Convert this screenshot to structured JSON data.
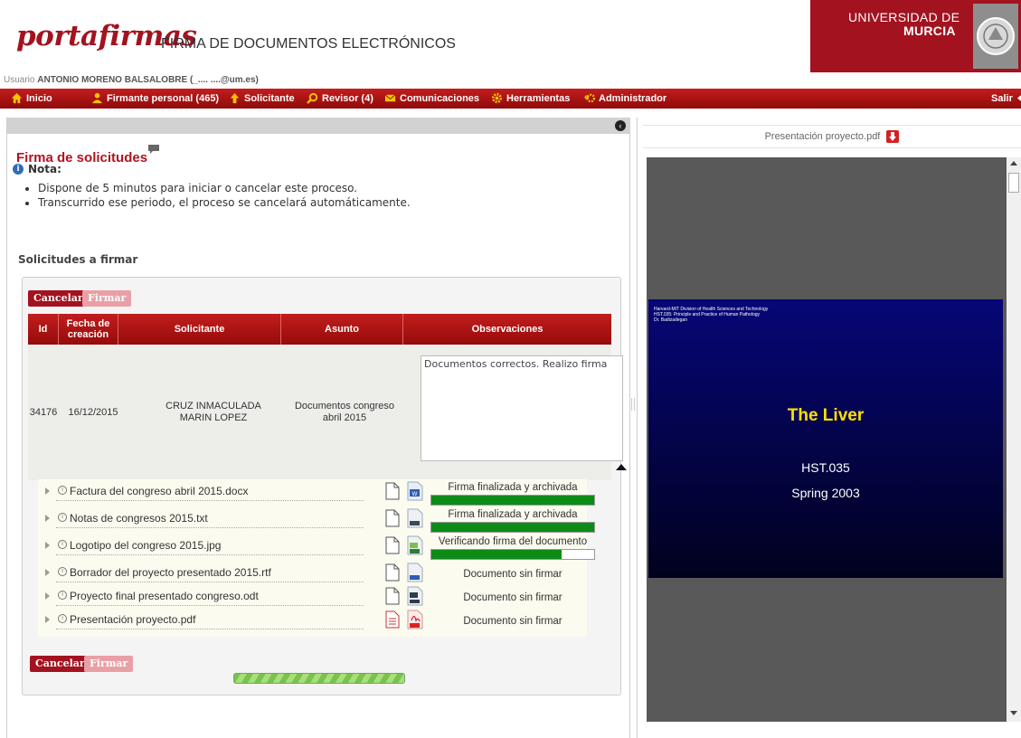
{
  "header": {
    "logo_text": "portafirmas",
    "subtitle": "FIRMA DE DOCUMENTOS ELECTRÓNICOS",
    "university_line1": "UNIVERSIDAD DE",
    "university_line2": "MURCIA",
    "user_prefix": "Usuario",
    "user_name": "ANTONIO MORENO BALSALOBRE (_.... ....@um.es)"
  },
  "nav": {
    "items": [
      {
        "label": "Inicio",
        "icon": "home-icon"
      },
      {
        "label": "Firmante personal (465)",
        "icon": "person-icon"
      },
      {
        "label": "Solicitante",
        "icon": "arrow-up-icon"
      },
      {
        "label": "Revisor (4)",
        "icon": "magnifier-icon"
      },
      {
        "label": "Comunicaciones",
        "icon": "envelope-icon"
      },
      {
        "label": "Herramientas",
        "icon": "gear-icon"
      },
      {
        "label": "Administrador",
        "icon": "admin-gear-icon"
      }
    ],
    "logout": "Salir"
  },
  "page": {
    "section_title": "Firma de solicitudes",
    "note_label": "Nota:",
    "note_items": [
      "Dispone de 5 minutos para iniciar o cancelar este proceso.",
      "Transcurrido ese periodo, el proceso se cancelará automáticamente."
    ],
    "requests_heading": "Solicitudes a firmar",
    "cancel_label": "Cancelar",
    "sign_label": "Firmar"
  },
  "table": {
    "headers": [
      "Id",
      "Fecha de creación",
      "Solicitante",
      "Asunto",
      "Observaciones"
    ],
    "row": {
      "id": "34176",
      "date": "16/12/2015",
      "requester": "CRUZ INMACULADA MARIN LOPEZ",
      "subject": "Documentos congreso abril 2015",
      "observations": "Documentos correctos. Realizo firma"
    }
  },
  "documents": [
    {
      "name": "Factura del congreso abril 2015.docx",
      "type": "docx",
      "status": "Firma finalizada y archivada",
      "progress": 1.0
    },
    {
      "name": "Notas de congresos 2015.txt",
      "type": "txt",
      "status": "Firma finalizada y archivada",
      "progress": 1.0
    },
    {
      "name": "Logotipo del congreso 2015.jpg",
      "type": "jpg",
      "status": "Verificando firma del documento",
      "progress": 0.8
    },
    {
      "name": "Borrador del proyecto presentado 2015.rtf",
      "type": "rtf",
      "status": "Documento sin firmar",
      "progress": null
    },
    {
      "name": "Proyecto final presentado congreso.odt",
      "type": "odt",
      "status": "Documento sin firmar",
      "progress": null
    },
    {
      "name": "Presentación proyecto.pdf",
      "type": "pdf",
      "status": "Documento sin firmar",
      "progress": null
    }
  ],
  "viewer": {
    "file_name": "Presentación proyecto.pdf",
    "slide_header": "Harvard-MIT Division of Health Sciences and Technology\nHST.035: Principle and Practice of Human Pathology\nDr. Badizadegan",
    "slide_title": "The Liver",
    "slide_code": "HST.035",
    "slide_term": "Spring 2003"
  },
  "colors": {
    "brand_red": "#a3121f",
    "progress_green": "#0d8b17",
    "slide_title_yellow": "#ffe000"
  }
}
